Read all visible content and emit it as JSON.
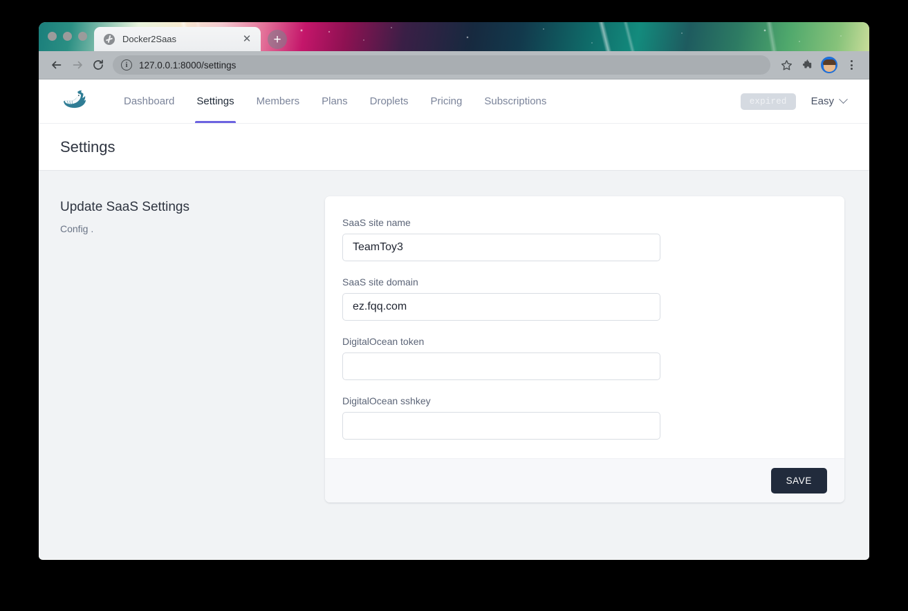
{
  "browser": {
    "tab": {
      "title": "Docker2Saas",
      "favicon": "globe-icon",
      "close": "✕"
    },
    "new_tab": "+",
    "back": "←",
    "forward": "→",
    "reload": "↻",
    "site_info": "i",
    "url": "127.0.0.1:8000/settings",
    "bookmark": "☆",
    "extensions": "puzzle-icon",
    "profile": "avatar-icon",
    "menu": "kebab-icon"
  },
  "site": {
    "logo": "whale-logo",
    "nav": [
      {
        "label": "Dashboard",
        "active": false
      },
      {
        "label": "Settings",
        "active": true
      },
      {
        "label": "Members",
        "active": false
      },
      {
        "label": "Plans",
        "active": false
      },
      {
        "label": "Droplets",
        "active": false
      },
      {
        "label": "Pricing",
        "active": false
      },
      {
        "label": "Subscriptions",
        "active": false
      }
    ],
    "status_badge": "expired",
    "user_name": "Easy"
  },
  "page": {
    "title": "Settings"
  },
  "intro": {
    "heading": "Update SaaS Settings",
    "description": "Config ."
  },
  "form": {
    "fields": [
      {
        "label": "SaaS site name",
        "value": "TeamToy3",
        "placeholder": ""
      },
      {
        "label": "SaaS site domain",
        "value": "ez.fqq.com",
        "placeholder": ""
      },
      {
        "label": "DigitalOcean token",
        "value": "",
        "placeholder": ""
      },
      {
        "label": "DigitalOcean sshkey",
        "value": "",
        "placeholder": ""
      }
    ],
    "save_label": "SAVE"
  },
  "colors": {
    "accent": "#6c63e0",
    "save_button": "#212b3c",
    "page_bg": "#f1f3f5",
    "logo_teal": "#2a7f9e",
    "badge_bg": "#d5dae1"
  }
}
